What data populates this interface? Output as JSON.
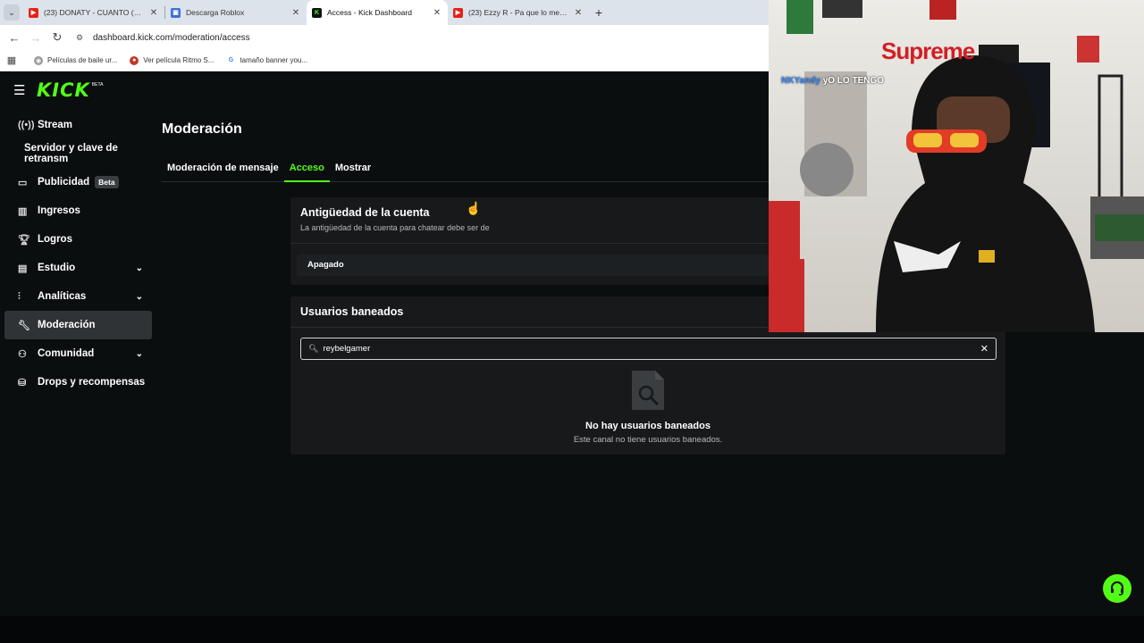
{
  "browser": {
    "tabs": [
      {
        "title": "(23) DONATY - CUANTO (VIDE",
        "favicon": "youtube-icon",
        "active": false
      },
      {
        "title": "Descarga Roblox",
        "favicon": "roblox-icon",
        "active": false
      },
      {
        "title": "Access - Kick Dashboard",
        "favicon": "kick-icon",
        "active": true
      },
      {
        "title": "(23) Ezzy R - Pa que lo meneee",
        "favicon": "youtube-icon",
        "active": false
      }
    ],
    "url": "dashboard.kick.com/moderation/access",
    "bookmarks": [
      {
        "label": "Películas de baile ur...",
        "icon": "globe-icon"
      },
      {
        "label": "Ver película Ritmo S...",
        "icon": "site-icon"
      },
      {
        "label": "tamaño banner you...",
        "icon": "google-icon"
      }
    ]
  },
  "app": {
    "logo": "KICK",
    "logo_badge": "BETA",
    "accent_color": "#53fc18",
    "nav": [
      {
        "label": "Stream",
        "icon": "broadcast-icon"
      },
      {
        "label": "Servidor y clave de retransm",
        "icon": ""
      },
      {
        "label": "Publicidad",
        "icon": "ads-icon",
        "badge": "Beta"
      },
      {
        "label": "Ingresos",
        "icon": "chart-icon"
      },
      {
        "label": "Logros",
        "icon": "trophy-icon"
      },
      {
        "label": "Estudio",
        "icon": "studio-icon",
        "expandable": true
      },
      {
        "label": "Analíticas",
        "icon": "analytics-icon",
        "expandable": true
      },
      {
        "label": "Moderación",
        "icon": "wrench-icon",
        "active": true
      },
      {
        "label": "Comunidad",
        "icon": "community-icon",
        "expandable": true
      },
      {
        "label": "Drops y recompensas",
        "icon": "drops-icon"
      }
    ],
    "page_title": "Moderación",
    "tabs": [
      {
        "label": "Moderación de mensaje",
        "active": false
      },
      {
        "label": "Acceso",
        "active": true
      },
      {
        "label": "Mostrar",
        "active": false
      }
    ],
    "account_age": {
      "title": "Antigüedad de la cuenta",
      "description": "La antigüedad de la cuenta para chatear debe ser de",
      "selected": "Apagado"
    },
    "banned_users": {
      "title": "Usuarios baneados",
      "search_value": "reybelgamer",
      "empty_title": "No hay usuarios baneados",
      "empty_subtitle": "Este canal no tiene usuarios baneados."
    }
  },
  "webcam": {
    "sign": "Supreme",
    "caption_name": "NKYandy",
    "caption_text": "yO LO TENGO"
  }
}
